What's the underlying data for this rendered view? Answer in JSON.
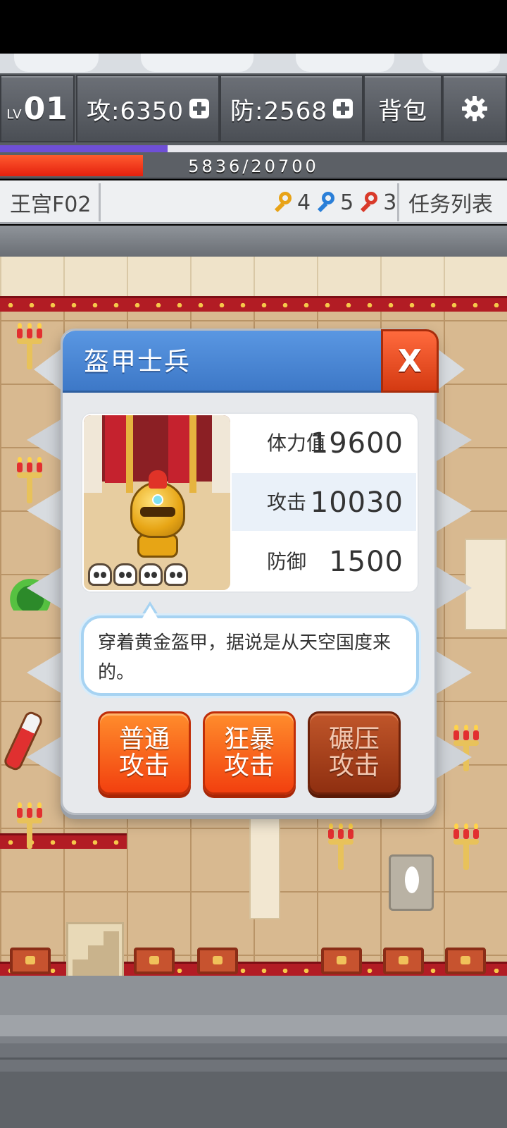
{
  "hud": {
    "level_prefix": "LV",
    "level": "01",
    "attack": "攻:6350",
    "defense": "防:2568",
    "bag": "背包",
    "settings_icon": "gear-icon"
  },
  "exp_progress": 0.33,
  "hp": {
    "text": "5836/20700",
    "current": 5836,
    "max": 20700
  },
  "info": {
    "floor": "王宫F02",
    "keys": [
      {
        "color": "#e8a317",
        "count": "4",
        "icon": "yellow-key-icon"
      },
      {
        "color": "#2a7fd8",
        "count": "5",
        "icon": "blue-key-icon"
      },
      {
        "color": "#d93a2a",
        "count": "3",
        "icon": "red-key-icon"
      }
    ],
    "task_list": "任务列表"
  },
  "dialog": {
    "title": "盔甲士兵",
    "close_label": "X",
    "stats": [
      {
        "label": "体力值",
        "value": "19600"
      },
      {
        "label": "攻击",
        "value": "10030"
      },
      {
        "label": "防御",
        "value": "1500"
      }
    ],
    "description": "穿着黄金盔甲，据说是从天空国度来的。",
    "buttons": [
      {
        "line1": "普通",
        "line2": "攻击",
        "style": "orange"
      },
      {
        "line1": "狂暴",
        "line2": "攻击",
        "style": "orange"
      },
      {
        "line1": "碾压",
        "line2": "攻击",
        "style": "brown"
      }
    ]
  }
}
